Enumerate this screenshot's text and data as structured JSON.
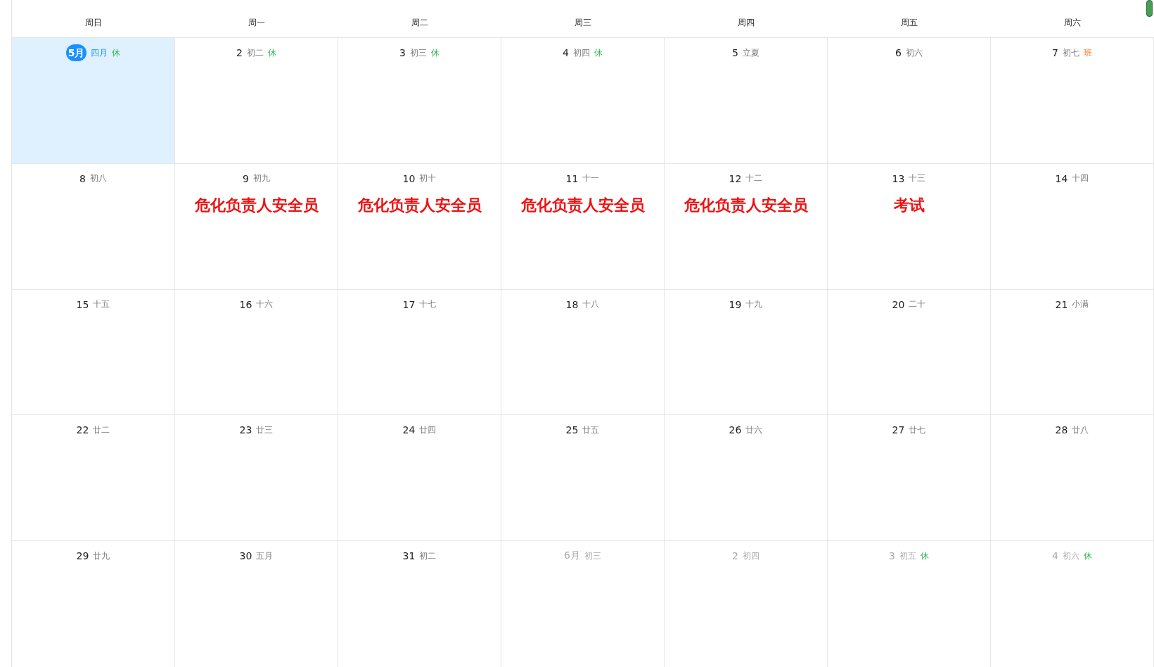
{
  "weekdays": [
    "周日",
    "周一",
    "周二",
    "周三",
    "周四",
    "周五",
    "周六"
  ],
  "weeks": [
    [
      {
        "day": "5月",
        "lunar": "四月",
        "badge": {
          "kind": "rest",
          "text": "休"
        },
        "selected": true,
        "other_month": false
      },
      {
        "day": "2",
        "lunar": "初二",
        "badge": {
          "kind": "rest",
          "text": "休"
        },
        "selected": false,
        "other_month": false
      },
      {
        "day": "3",
        "lunar": "初三",
        "badge": {
          "kind": "rest",
          "text": "休"
        },
        "selected": false,
        "other_month": false
      },
      {
        "day": "4",
        "lunar": "初四",
        "badge": {
          "kind": "rest",
          "text": "休"
        },
        "selected": false,
        "other_month": false
      },
      {
        "day": "5",
        "lunar": "立夏",
        "selected": false,
        "other_month": false
      },
      {
        "day": "6",
        "lunar": "初六",
        "selected": false,
        "other_month": false
      },
      {
        "day": "7",
        "lunar": "初七",
        "badge": {
          "kind": "work",
          "text": "班"
        },
        "selected": false,
        "other_month": false
      }
    ],
    [
      {
        "day": "8",
        "lunar": "初八",
        "selected": false,
        "other_month": false
      },
      {
        "day": "9",
        "lunar": "初九",
        "selected": false,
        "other_month": false,
        "events": [
          "危化负责人安全员"
        ]
      },
      {
        "day": "10",
        "lunar": "初十",
        "selected": false,
        "other_month": false,
        "events": [
          "危化负责人安全员"
        ]
      },
      {
        "day": "11",
        "lunar": "十一",
        "selected": false,
        "other_month": false,
        "events": [
          "危化负责人安全员"
        ]
      },
      {
        "day": "12",
        "lunar": "十二",
        "selected": false,
        "other_month": false,
        "events": [
          "危化负责人安全员"
        ]
      },
      {
        "day": "13",
        "lunar": "十三",
        "selected": false,
        "other_month": false,
        "events": [
          "考试"
        ]
      },
      {
        "day": "14",
        "lunar": "十四",
        "selected": false,
        "other_month": false
      }
    ],
    [
      {
        "day": "15",
        "lunar": "十五",
        "selected": false,
        "other_month": false
      },
      {
        "day": "16",
        "lunar": "十六",
        "selected": false,
        "other_month": false
      },
      {
        "day": "17",
        "lunar": "十七",
        "selected": false,
        "other_month": false
      },
      {
        "day": "18",
        "lunar": "十八",
        "selected": false,
        "other_month": false
      },
      {
        "day": "19",
        "lunar": "十九",
        "selected": false,
        "other_month": false
      },
      {
        "day": "20",
        "lunar": "二十",
        "selected": false,
        "other_month": false
      },
      {
        "day": "21",
        "lunar": "小满",
        "selected": false,
        "other_month": false
      }
    ],
    [
      {
        "day": "22",
        "lunar": "廿二",
        "selected": false,
        "other_month": false
      },
      {
        "day": "23",
        "lunar": "廿三",
        "selected": false,
        "other_month": false
      },
      {
        "day": "24",
        "lunar": "廿四",
        "selected": false,
        "other_month": false
      },
      {
        "day": "25",
        "lunar": "廿五",
        "selected": false,
        "other_month": false
      },
      {
        "day": "26",
        "lunar": "廿六",
        "selected": false,
        "other_month": false
      },
      {
        "day": "27",
        "lunar": "廿七",
        "selected": false,
        "other_month": false
      },
      {
        "day": "28",
        "lunar": "廿八",
        "selected": false,
        "other_month": false
      }
    ],
    [
      {
        "day": "29",
        "lunar": "廿九",
        "selected": false,
        "other_month": false
      },
      {
        "day": "30",
        "lunar": "五月",
        "selected": false,
        "other_month": false
      },
      {
        "day": "31",
        "lunar": "初二",
        "selected": false,
        "other_month": false
      },
      {
        "day": "6月",
        "lunar": "初三",
        "selected": false,
        "other_month": true
      },
      {
        "day": "2",
        "lunar": "初四",
        "selected": false,
        "other_month": true
      },
      {
        "day": "3",
        "lunar": "初五",
        "badge": {
          "kind": "rest",
          "text": "休"
        },
        "selected": false,
        "other_month": true
      },
      {
        "day": "4",
        "lunar": "初六",
        "badge": {
          "kind": "rest",
          "text": "休"
        },
        "selected": false,
        "other_month": true
      }
    ]
  ]
}
